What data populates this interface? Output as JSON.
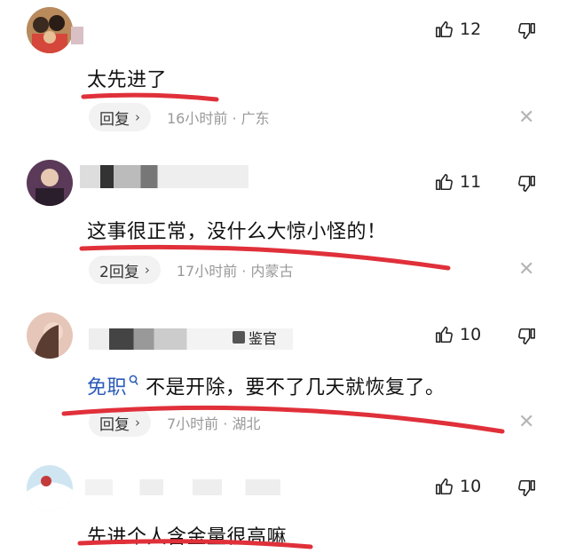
{
  "comments": [
    {
      "id": "c1",
      "likes": "12",
      "text": "太先进了",
      "reply_label": "回复",
      "time_location": "16小时前 · 广东"
    },
    {
      "id": "c2",
      "likes": "11",
      "text": "这事很正常，没什么大惊小怪的！",
      "reply_label": "2回复",
      "time_location": "17小时前 · 内蒙古"
    },
    {
      "id": "c3",
      "likes": "10",
      "badge": "鉴官",
      "link_text": "免职",
      "text": "不是开除，要不了几天就恢复了。",
      "reply_label": "回复",
      "time_location": "7小时前 · 湖北"
    },
    {
      "id": "c4",
      "likes": "10",
      "text": "先进个人含金量很高嘛"
    }
  ],
  "colors": {
    "underline": "#e0303a",
    "link": "#2b5bb8",
    "meta": "#999999"
  },
  "icons": {
    "like": "thumbs-up-icon",
    "dislike": "thumbs-down-icon",
    "close": "close-icon",
    "search": "search-icon"
  }
}
